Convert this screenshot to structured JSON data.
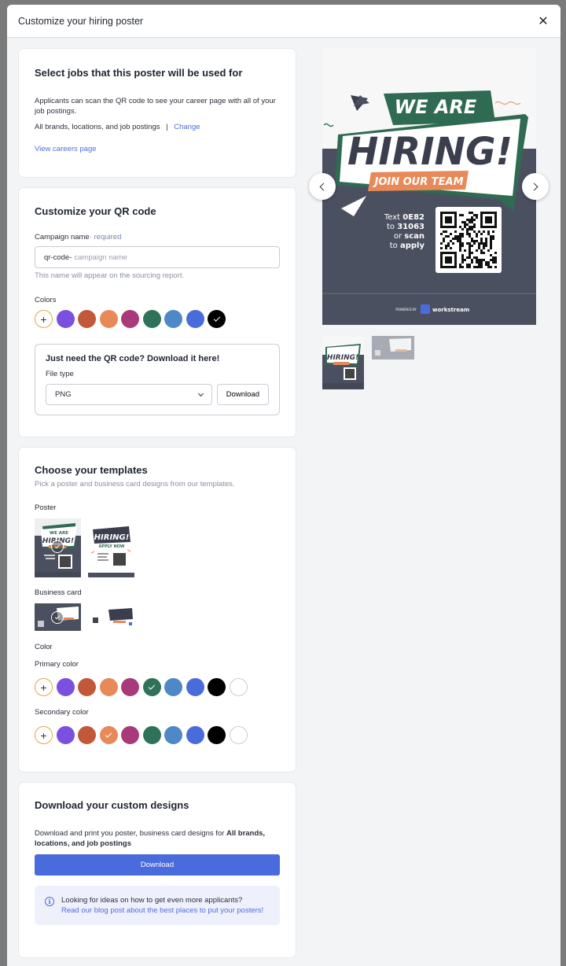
{
  "modal": {
    "title": "Customize your hiring poster"
  },
  "jobs": {
    "title": "Select jobs that this poster will be used for",
    "description": "Applicants can scan the QR code to see your career page with all of your job postings.",
    "selection": "All brands, locations, and job postings",
    "separator": "|",
    "change_link": "Change",
    "careers_link": "View careers page"
  },
  "qr": {
    "title": "Customize your QR code",
    "campaign_label": "Campaign name",
    "required_label": "· required",
    "prefix": "qr-code-",
    "placeholder": "campaign name",
    "hint": "This name will appear on the sourcing report.",
    "colors_label": "Colors",
    "colors": [
      "#7b4fe0",
      "#c2573a",
      "#e8895a",
      "#a83a7a",
      "#2f7259",
      "#4f88c6",
      "#4a6bdc",
      "#000000"
    ],
    "selected_color": "#000000",
    "download_title": "Just need the QR code? Download it here!",
    "file_type_label": "File type",
    "file_type_value": "PNG",
    "download_button": "Download"
  },
  "templates": {
    "title": "Choose your templates",
    "subtitle": "Pick a poster and business card designs from our templates.",
    "poster_label": "Poster",
    "business_card_label": "Business card",
    "color_label": "Color",
    "primary_label": "Primary color",
    "secondary_label": "Secondary color",
    "colors": [
      "#7b4fe0",
      "#c2573a",
      "#e8895a",
      "#a83a7a",
      "#2f7259",
      "#4f88c6",
      "#4a6bdc",
      "#000000",
      "#ffffff"
    ],
    "primary_selected": "#2f7259",
    "secondary_selected": "#e8895a",
    "thumb_we_are": "WE ARE",
    "thumb_hiring": "HIRING!",
    "thumb_apply": "APPLY NOW"
  },
  "download": {
    "title": "Download your custom designs",
    "text_prefix": "Download and print you poster, business card designs for ",
    "text_bold": "All brands, locations, and job postings",
    "button": "Download",
    "info_text": "Looking for ideas on how to get even more applicants?",
    "info_link": "Read our blog post about the best places to put your posters!"
  },
  "poster": {
    "we_are": "WE ARE",
    "hiring": "HIRING!",
    "join": "JOIN OUR TEAM",
    "text_word": "Text",
    "code": "0E82",
    "to_word": "to",
    "number": "31063",
    "or_word": "or",
    "scan": "scan",
    "apply": "apply",
    "powered_by": "POWERED BY",
    "brand": "workstream",
    "primary": "#2f6b52",
    "accent": "#e8895a",
    "dark": "#4b5060"
  }
}
